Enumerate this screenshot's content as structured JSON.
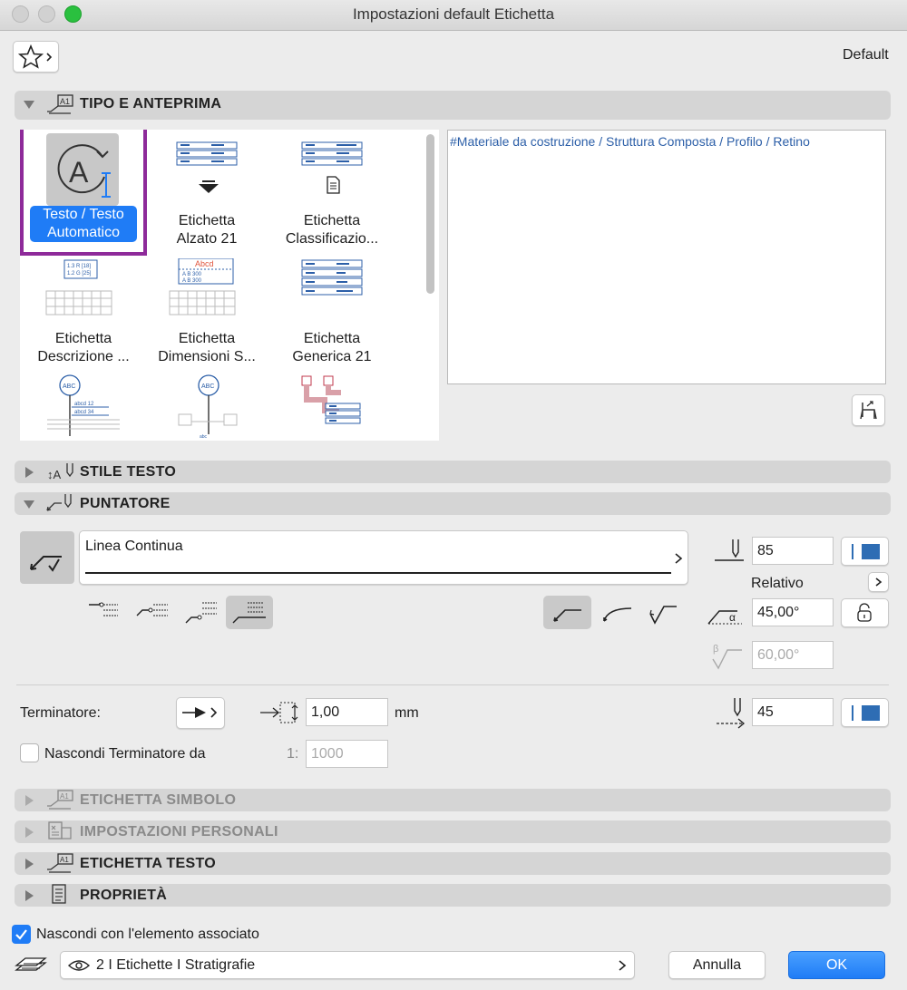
{
  "window": {
    "title": "Impostazioni default Etichetta"
  },
  "header": {
    "favorites_label": "",
    "default_label": "Default"
  },
  "sections": {
    "tipo": "TIPO E ANTEPRIMA",
    "stile": "STILE TESTO",
    "puntatore": "PUNTATORE",
    "simbolo": "ETICHETTA SIMBOLO",
    "personali": "IMPOSTAZIONI PERSONALI",
    "testo": "ETICHETTA TESTO",
    "proprieta": "PROPRIETÀ"
  },
  "library": {
    "items": [
      {
        "line1": "Testo / Testo",
        "line2": "Automatico",
        "selected": true
      },
      {
        "line1": "Etichetta",
        "line2": "Alzato 21"
      },
      {
        "line1": "Etichetta",
        "line2": "Classificazio..."
      },
      {
        "line1": "Etichetta",
        "line2": "Descrizione ..."
      },
      {
        "line1": "Etichetta",
        "line2": "Dimensioni S..."
      },
      {
        "line1": "Etichetta",
        "line2": "Generica 21"
      }
    ],
    "icon_texts": {
      "abc": "ABC",
      "abcd": "Abcd",
      "r1": "1.3 R [18]",
      "r2": "1.2 G [25]",
      "ab300": "A B    300",
      "abcd12": "abcd 12",
      "abcd34": "abcd 34",
      "abc_small": "abc"
    }
  },
  "preview": {
    "text": "#Materiale da costruzione / Struttura Composta / Profilo / Retino"
  },
  "puntatore": {
    "line_type": "Linea Continua",
    "pen_value": "85",
    "relativo_label": "Relativo",
    "angle_alpha": "45,00°",
    "angle_beta": "60,00°",
    "alpha_symbol": "α",
    "beta_symbol": "β"
  },
  "terminatore": {
    "label": "Terminatore:",
    "size_value": "1,00",
    "unit": "mm",
    "pen_value": "45",
    "hide_label": "Nascondi Terminatore da",
    "scale_prefix": "1:",
    "scale_value": "1000"
  },
  "footer": {
    "hide_with_element_label": "Nascondi con l'elemento associato",
    "layer": "2 I Etichette I Stratigrafie",
    "cancel": "Annulla",
    "ok": "OK"
  },
  "colors": {
    "accent": "#1f7cf6",
    "selection_border": "#8e2a9a",
    "preview_text": "#2c5fa8",
    "pen_blue": "#2e6db4"
  }
}
